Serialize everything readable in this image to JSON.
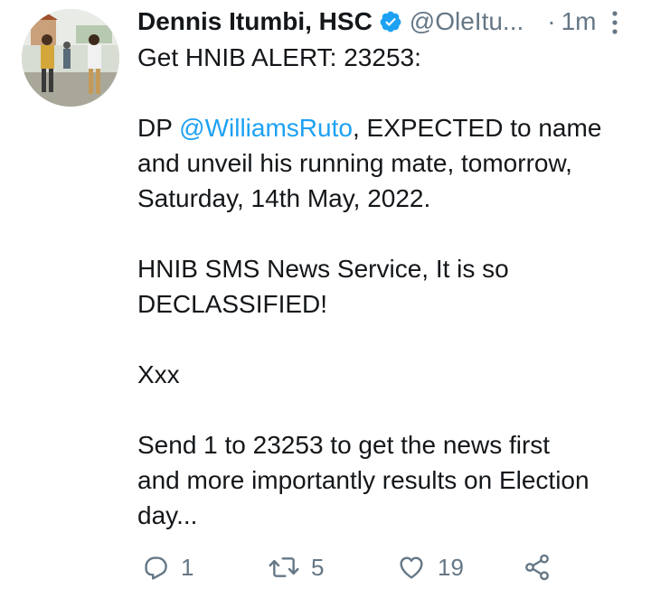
{
  "author": {
    "name": "Dennis Itumbi, HSC",
    "handle": "@OleItu...",
    "separator": "·",
    "time": "1m"
  },
  "tweet": {
    "line1": "Get HNIB ALERT: 23253:",
    "p2_prefix": "DP ",
    "p2_mention": "@WilliamsRuto",
    "p2_suffix": ", EXPECTED to name",
    "p2_line2": "and unveil his running mate, tomorrow,",
    "p2_line3": "Saturday, 14th May, 2022.",
    "p3_line1": "HNIB SMS News Service, It is so",
    "p3_line2": "DECLASSIFIED!",
    "p4": "Xxx",
    "p5_line1": "Send 1 to 23253 to get the news first",
    "p5_line2": "and more importantly results on Election",
    "p5_line3": "day..."
  },
  "actions": {
    "reply_count": "1",
    "retweet_count": "5",
    "like_count": "19"
  },
  "colors": {
    "link": "#1da1f2",
    "muted": "#657786",
    "text": "#14171a",
    "verified": "#1da1f2"
  },
  "icons": [
    "verified-badge-icon",
    "more-options-icon",
    "reply-icon",
    "retweet-icon",
    "like-icon",
    "share-icon"
  ]
}
